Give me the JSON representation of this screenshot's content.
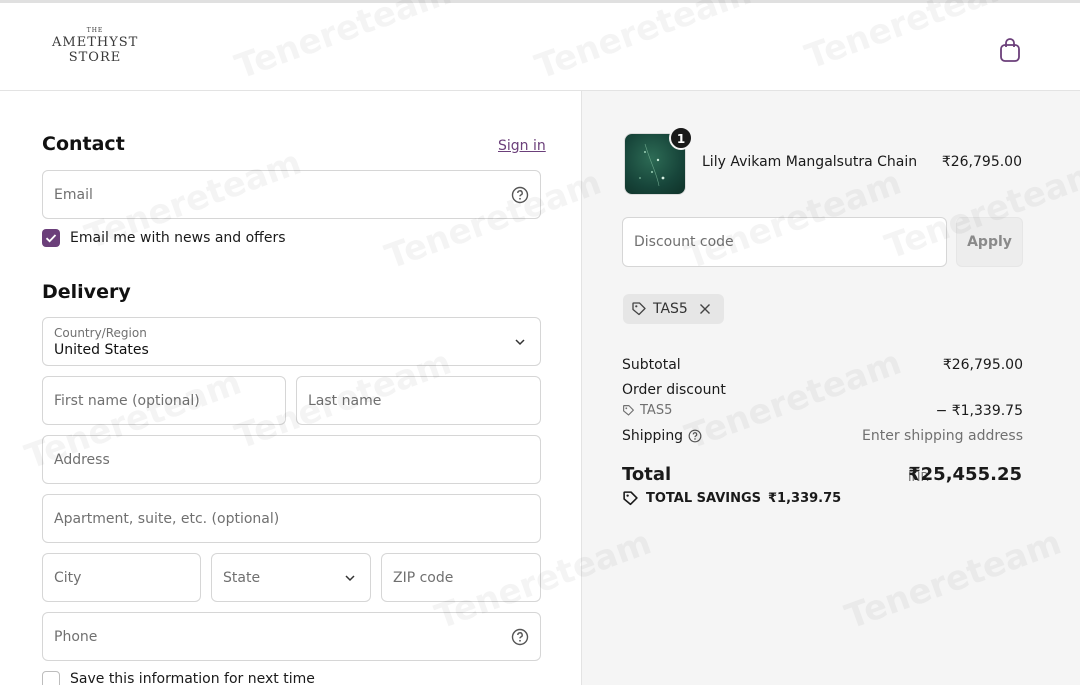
{
  "header": {
    "logo_the": "THE",
    "logo_line1": "AMETHYST",
    "logo_line2": "STORE",
    "cart_icon": "shopping-bag-icon"
  },
  "contact": {
    "heading": "Contact",
    "sign_in": "Sign in",
    "email_placeholder": "Email",
    "newsletter_label": "Email me with news and offers",
    "newsletter_checked": true
  },
  "delivery": {
    "heading": "Delivery",
    "country_label": "Country/Region",
    "country_value": "United States",
    "first_name_placeholder": "First name (optional)",
    "last_name_placeholder": "Last name",
    "address_placeholder": "Address",
    "apartment_placeholder": "Apartment, suite, etc. (optional)",
    "city_placeholder": "City",
    "state_placeholder": "State",
    "zip_placeholder": "ZIP code",
    "phone_placeholder": "Phone",
    "save_info_label": "Save this information for next time",
    "save_info_checked": false
  },
  "summary": {
    "product": {
      "quantity": "1",
      "name": "Lily Avikam Mangalsutra Chain",
      "price": "₹26,795.00"
    },
    "discount_placeholder": "Discount code",
    "apply_label": "Apply",
    "applied_code": "TAS5",
    "subtotal_label": "Subtotal",
    "subtotal_value": "₹26,795.00",
    "order_discount_label": "Order discount",
    "discount_code": "TAS5",
    "discount_value": "− ₹1,339.75",
    "shipping_label": "Shipping",
    "shipping_value": "Enter shipping address",
    "total_label": "Total",
    "total_currency": "INR",
    "total_value": "₹25,455.25",
    "savings_label": "TOTAL SAVINGS",
    "savings_value": "₹1,339.75"
  },
  "watermark": "Tenereteam",
  "colors": {
    "accent": "#6b3f7a",
    "summary_bg": "#f5f5f5",
    "border": "#d6d6d6"
  }
}
